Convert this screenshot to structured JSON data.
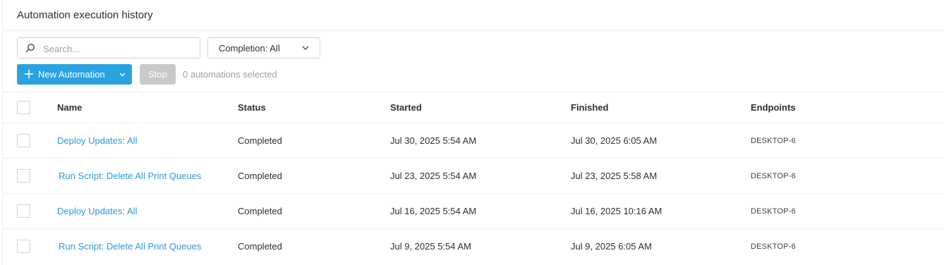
{
  "header": {
    "title": "Automation execution history"
  },
  "search": {
    "placeholder": "Search...",
    "icon": "search-icon"
  },
  "filter": {
    "label": "Completion: All",
    "icon": "chevron-down-icon"
  },
  "toolbar": {
    "new_label": "New Automation",
    "stop_label": "Stop",
    "selected_text": "0 automations selected"
  },
  "colors": {
    "accent": "#29a3e0",
    "link": "#2a9cd8",
    "disabled": "#c8c9cb"
  },
  "table": {
    "columns": [
      "Name",
      "Status",
      "Started",
      "Finished",
      "Endpoints"
    ],
    "rows": [
      {
        "name": "Deploy Updates: All",
        "status": "Completed",
        "started": "Jul 30, 2025 5:54 AM",
        "finished": "Jul 30, 2025 6:05 AM",
        "endpoints": "DESKTOP-6"
      },
      {
        "name": "Run Script: Delete All Print Queues",
        "status": "Completed",
        "started": "Jul 23, 2025 5:54 AM",
        "finished": "Jul 23, 2025 5:58 AM",
        "endpoints": "DESKTOP-6"
      },
      {
        "name": "Deploy Updates: All",
        "status": "Completed",
        "started": "Jul 16, 2025 5:54 AM",
        "finished": "Jul 16, 2025 10:16 AM",
        "endpoints": "DESKTOP-6"
      },
      {
        "name": "Run Script: Delete All Print Queues",
        "status": "Completed",
        "started": "Jul 9, 2025 5:54 AM",
        "finished": "Jul 9, 2025 6:05 AM",
        "endpoints": "DESKTOP-6"
      }
    ]
  }
}
